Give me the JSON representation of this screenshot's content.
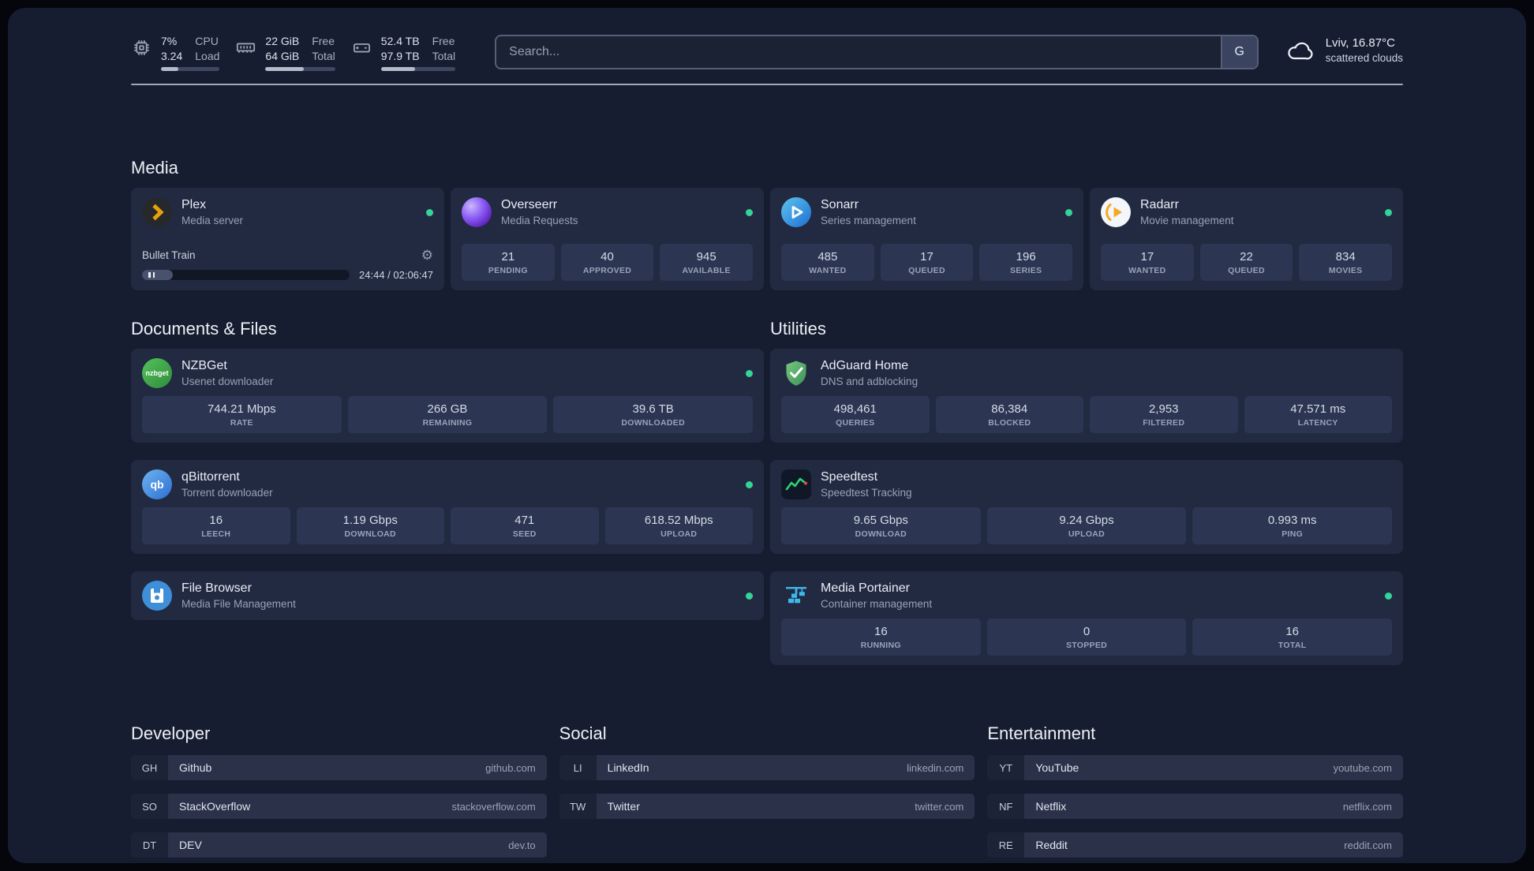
{
  "topbar": {
    "cpu": {
      "value_top": "7%",
      "value_bottom": "3.24",
      "label_top": "CPU",
      "label_bottom": "Load",
      "bar_pct": 30
    },
    "memory": {
      "value_top": "22 GiB",
      "value_bottom": "64 GiB",
      "label_top": "Free",
      "label_bottom": "Total",
      "bar_pct": 55
    },
    "disk": {
      "value_top": "52.4 TB",
      "value_bottom": "97.9 TB",
      "label_top": "Free",
      "label_bottom": "Total",
      "bar_pct": 46
    },
    "search": {
      "placeholder": "Search...",
      "provider": "G"
    },
    "weather": {
      "location": "Lviv, 16.87°C",
      "condition": "scattered clouds"
    }
  },
  "media": {
    "title": "Media",
    "plex": {
      "name": "Plex",
      "desc": "Media server",
      "now_playing": "Bullet Train",
      "time": "24:44 / 02:06:47",
      "progress_pct": 15
    },
    "overseerr": {
      "name": "Overseerr",
      "desc": "Media Requests",
      "stats": [
        {
          "value": "21",
          "label": "PENDING"
        },
        {
          "value": "40",
          "label": "APPROVED"
        },
        {
          "value": "945",
          "label": "AVAILABLE"
        }
      ]
    },
    "sonarr": {
      "name": "Sonarr",
      "desc": "Series management",
      "stats": [
        {
          "value": "485",
          "label": "WANTED"
        },
        {
          "value": "17",
          "label": "QUEUED"
        },
        {
          "value": "196",
          "label": "SERIES"
        }
      ]
    },
    "radarr": {
      "name": "Radarr",
      "desc": "Movie management",
      "stats": [
        {
          "value": "17",
          "label": "WANTED"
        },
        {
          "value": "22",
          "label": "QUEUED"
        },
        {
          "value": "834",
          "label": "MOVIES"
        }
      ]
    }
  },
  "documents": {
    "title": "Documents & Files",
    "nzbget": {
      "name": "NZBGet",
      "desc": "Usenet downloader",
      "stats": [
        {
          "value": "744.21 Mbps",
          "label": "RATE"
        },
        {
          "value": "266 GB",
          "label": "REMAINING"
        },
        {
          "value": "39.6 TB",
          "label": "DOWNLOADED"
        }
      ]
    },
    "qbittorrent": {
      "name": "qBittorrent",
      "desc": "Torrent downloader",
      "stats": [
        {
          "value": "16",
          "label": "LEECH"
        },
        {
          "value": "1.19 Gbps",
          "label": "DOWNLOAD"
        },
        {
          "value": "471",
          "label": "SEED"
        },
        {
          "value": "618.52 Mbps",
          "label": "UPLOAD"
        }
      ]
    },
    "filebrowser": {
      "name": "File Browser",
      "desc": "Media File Management"
    }
  },
  "utilities": {
    "title": "Utilities",
    "adguard": {
      "name": "AdGuard Home",
      "desc": "DNS and adblocking",
      "stats": [
        {
          "value": "498,461",
          "label": "QUERIES"
        },
        {
          "value": "86,384",
          "label": "BLOCKED"
        },
        {
          "value": "2,953",
          "label": "FILTERED"
        },
        {
          "value": "47.571 ms",
          "label": "LATENCY"
        }
      ]
    },
    "speedtest": {
      "name": "Speedtest",
      "desc": "Speedtest Tracking",
      "stats": [
        {
          "value": "9.65 Gbps",
          "label": "DOWNLOAD"
        },
        {
          "value": "9.24 Gbps",
          "label": "UPLOAD"
        },
        {
          "value": "0.993 ms",
          "label": "PING"
        }
      ]
    },
    "portainer": {
      "name": "Media Portainer",
      "desc": "Container management",
      "stats": [
        {
          "value": "16",
          "label": "RUNNING"
        },
        {
          "value": "0",
          "label": "STOPPED"
        },
        {
          "value": "16",
          "label": "TOTAL"
        }
      ]
    }
  },
  "bookmarks": {
    "developer": {
      "title": "Developer",
      "items": [
        {
          "abbr": "GH",
          "name": "Github",
          "domain": "github.com"
        },
        {
          "abbr": "SO",
          "name": "StackOverflow",
          "domain": "stackoverflow.com"
        },
        {
          "abbr": "DT",
          "name": "DEV",
          "domain": "dev.to"
        }
      ]
    },
    "social": {
      "title": "Social",
      "items": [
        {
          "abbr": "LI",
          "name": "LinkedIn",
          "domain": "linkedin.com"
        },
        {
          "abbr": "TW",
          "name": "Twitter",
          "domain": "twitter.com"
        }
      ]
    },
    "entertainment": {
      "title": "Entertainment",
      "items": [
        {
          "abbr": "YT",
          "name": "YouTube",
          "domain": "youtube.com"
        },
        {
          "abbr": "NF",
          "name": "Netflix",
          "domain": "netflix.com"
        },
        {
          "abbr": "RE",
          "name": "Reddit",
          "domain": "reddit.com"
        }
      ]
    }
  },
  "icons": {
    "gear": "⚙",
    "nzbget_label": "nzbget",
    "qbittorrent_label": "qb"
  },
  "colors": {
    "status_online": "#34d399",
    "plex_gold": "#e5a00d",
    "divider": "#b9bfca"
  }
}
